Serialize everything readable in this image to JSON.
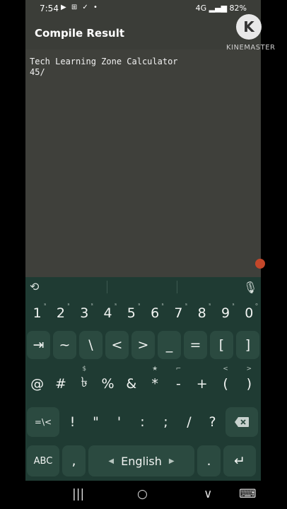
{
  "status": {
    "time": "7:54",
    "notification_icons": "▶ ⊞ ✓ •",
    "right_text": "4G ▂▄▆ 82%",
    "battery_icon": "battery-icon"
  },
  "watermark": {
    "logo_letter": "K",
    "text": "KINEMASTER"
  },
  "appbar": {
    "title": "Compile Result"
  },
  "output": {
    "line1": "Tech Learning Zone Calculator",
    "line2": "45/"
  },
  "keyboard": {
    "top_icons": [
      "clipboard-icon",
      "mic-icon"
    ],
    "numbers": [
      {
        "main": "1",
        "sup": "ˢ"
      },
      {
        "main": "2",
        "sup": "ˢ"
      },
      {
        "main": "3",
        "sup": "ˢ"
      },
      {
        "main": "4",
        "sup": "ˢ"
      },
      {
        "main": "5",
        "sup": "ˢ"
      },
      {
        "main": "6",
        "sup": "ˢ"
      },
      {
        "main": "7",
        "sup": "ˢ"
      },
      {
        "main": "8",
        "sup": "ˢ"
      },
      {
        "main": "9",
        "sup": "ˢ"
      },
      {
        "main": "0",
        "sup": "ᵒ"
      }
    ],
    "row2": [
      "⇥",
      "~",
      "\\",
      "<",
      ">",
      "_",
      "=",
      "[",
      "]"
    ],
    "row3": [
      {
        "main": "@",
        "sup": ""
      },
      {
        "main": "#",
        "sup": ""
      },
      {
        "main": "৳",
        "sup": "$"
      },
      {
        "main": "%",
        "sup": ""
      },
      {
        "main": "&",
        "sup": ""
      },
      {
        "main": "*",
        "sup": "★"
      },
      {
        "main": "-",
        "sup": "⌐"
      },
      {
        "main": "+",
        "sup": ""
      },
      {
        "main": "(",
        "sup": "<"
      },
      {
        "main": ")",
        "sup": ">"
      }
    ],
    "row4": [
      "=\\<",
      "!",
      "\"",
      "'",
      ":",
      ";",
      "/",
      "?"
    ],
    "backspace_icon": "backspace-icon",
    "bottom": {
      "abc": "ABC",
      "comma": ",",
      "space": "English",
      "period": ".",
      "enter": "↵"
    }
  },
  "navbar": {
    "recents": "|||",
    "home": "○",
    "back": "∨",
    "keyboard": "⌨"
  }
}
